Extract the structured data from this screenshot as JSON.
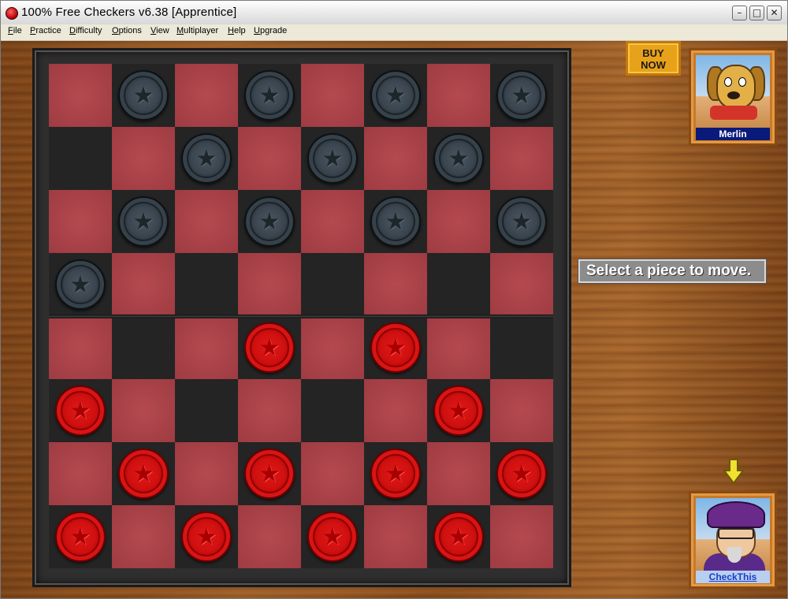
{
  "window": {
    "title": "100% Free Checkers v6.38 [Apprentice]",
    "controls": {
      "minimize": "–",
      "maximize": "□",
      "close": "✕"
    }
  },
  "menu": [
    {
      "label": "File",
      "accel": "F"
    },
    {
      "label": "Practice",
      "accel": "P"
    },
    {
      "label": "Difficulty",
      "accel": "D"
    },
    {
      "label": "Options",
      "accel": "O"
    },
    {
      "label": "View",
      "accel": "V"
    },
    {
      "label": "Multiplayer",
      "accel": "M"
    },
    {
      "label": "Help",
      "accel": "H"
    },
    {
      "label": "Upgrade",
      "accel": "U"
    }
  ],
  "buy_now": {
    "line1": "BUY",
    "line2": "NOW"
  },
  "opponent": {
    "name": "Merlin"
  },
  "player": {
    "name": "CheckThis"
  },
  "status_message": "Select a piece to move.",
  "turn_indicator": "down-arrow-icon",
  "board": {
    "size": 8,
    "rows": [
      "-b-b-b-b",
      ".-b-b-b-",
      "-b-b-b-b",
      "b-.-.-.-",
      "-.-r-r-.",
      "r-.-.-r-",
      "-r-r-r-r",
      "r-r-r-r-"
    ],
    "legend": {
      "b": "black piece",
      "r": "red piece",
      ".": "empty dark square",
      "-": "light square"
    }
  },
  "colors": {
    "light_square": "#a9434a",
    "dark_square": "#242424",
    "red_piece": "#d01010",
    "black_piece": "#3a454f",
    "status_bg": "#8c8c8c"
  }
}
